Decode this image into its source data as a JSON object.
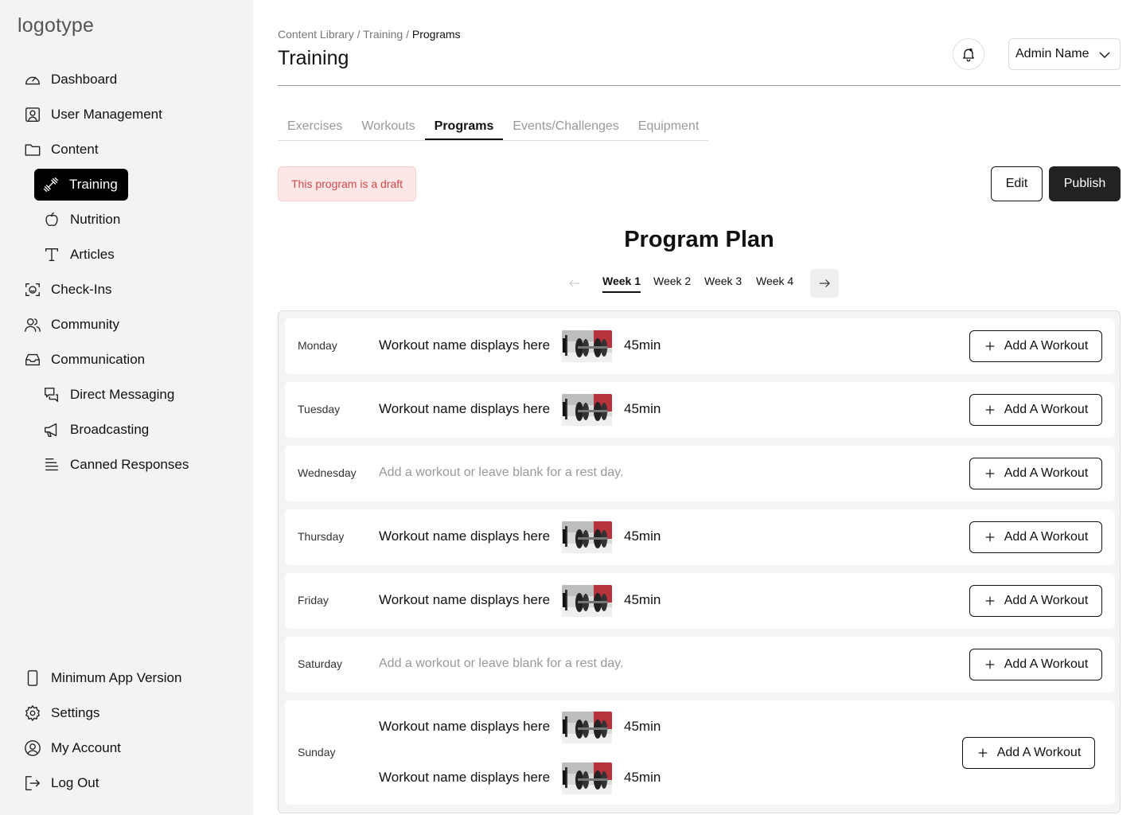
{
  "sidebar": {
    "logo": "logotype",
    "items": [
      {
        "label": "Dashboard",
        "icon": "gauge-icon"
      },
      {
        "label": "User Management",
        "icon": "user-badge-icon"
      },
      {
        "label": "Content",
        "icon": "folder-icon"
      },
      {
        "label": "Training",
        "icon": "dumbbell-icon",
        "active": true
      },
      {
        "label": "Nutrition",
        "icon": "apple-icon"
      },
      {
        "label": "Articles",
        "icon": "text-icon"
      },
      {
        "label": "Check-Ins",
        "icon": "face-scan-icon"
      },
      {
        "label": "Community",
        "icon": "users-icon"
      },
      {
        "label": "Communication",
        "icon": "inbox-icon"
      },
      {
        "label": "Direct Messaging",
        "icon": "chat-icon"
      },
      {
        "label": "Broadcasting",
        "icon": "megaphone-icon"
      },
      {
        "label": "Canned Responses",
        "icon": "lines-icon"
      }
    ],
    "bottom_items": [
      {
        "label": "Minimum App Version",
        "icon": "phone-icon"
      },
      {
        "label": "Settings",
        "icon": "gear-icon"
      },
      {
        "label": "My Account",
        "icon": "account-icon"
      },
      {
        "label": "Log Out",
        "icon": "logout-icon"
      }
    ]
  },
  "header": {
    "breadcrumb": [
      "Content Library",
      "Training",
      "Programs"
    ],
    "breadcrumb_sep": " / ",
    "title": "Training",
    "admin_name": "Admin Name"
  },
  "tabs": [
    {
      "label": "Exercises"
    },
    {
      "label": "Workouts"
    },
    {
      "label": "Programs",
      "active": true
    },
    {
      "label": "Events/Challenges"
    },
    {
      "label": "Equipment"
    }
  ],
  "draft_notice": "This program is a draft",
  "actions": {
    "edit": "Edit",
    "publish": "Publish"
  },
  "plan": {
    "title": "Program Plan",
    "weeks": [
      "Week 1",
      "Week 2",
      "Week 3",
      "Week 4"
    ],
    "active_week": "Week 1",
    "add_label": "Add A Workout",
    "rest_text": "Add a workout or leave blank for a rest day.",
    "days": [
      {
        "day": "Monday",
        "workouts": [
          {
            "name": "Workout name displays here",
            "duration": "45min"
          }
        ]
      },
      {
        "day": "Tuesday",
        "workouts": [
          {
            "name": "Workout name displays here",
            "duration": "45min"
          }
        ]
      },
      {
        "day": "Wednesday",
        "workouts": []
      },
      {
        "day": "Thursday",
        "workouts": [
          {
            "name": "Workout name displays here",
            "duration": "45min"
          }
        ]
      },
      {
        "day": "Friday",
        "workouts": [
          {
            "name": "Workout name displays here",
            "duration": "45min"
          }
        ]
      },
      {
        "day": "Saturday",
        "workouts": []
      },
      {
        "day": "Sunday",
        "workouts": [
          {
            "name": "Workout name displays here",
            "duration": "45min"
          },
          {
            "name": "Workout name displays here",
            "duration": "45min"
          }
        ]
      }
    ]
  }
}
